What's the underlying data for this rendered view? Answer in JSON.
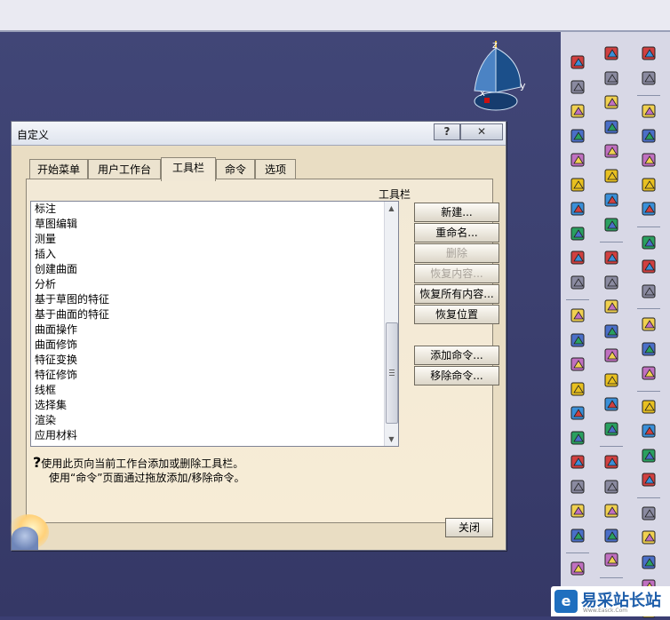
{
  "dialog": {
    "title": "自定义",
    "help_button": "?",
    "close_x": "✕",
    "tabs": [
      {
        "label": "开始菜单",
        "active": false
      },
      {
        "label": "用户工作台",
        "active": false
      },
      {
        "label": "工具栏",
        "active": true
      },
      {
        "label": "命令",
        "active": false
      },
      {
        "label": "选项",
        "active": false
      }
    ],
    "list_header": "工具栏",
    "toolbars": [
      "标注",
      "草图编辑",
      "测量",
      "插入",
      "创建曲面",
      "分析",
      "基于草图的特征",
      "基于曲面的特征",
      "曲面操作",
      "曲面修饰",
      "特征变换",
      "特征修饰",
      "线框",
      "选择集",
      "渲染",
      "应用材料"
    ],
    "buttons": {
      "new": "新建...",
      "rename": "重命名...",
      "delete": "删除",
      "restore_contents": "恢复内容...",
      "restore_all": "恢复所有内容...",
      "restore_position": "恢复位置",
      "add_command": "添加命令...",
      "remove_command": "移除命令..."
    },
    "hint_line1": "使用此页向当前工作台添加或删除工具栏。",
    "hint_line2": "使用“命令”页面通过拖放添加/移除命令。",
    "close_label": "关闭"
  },
  "compass": {
    "z_label": "z",
    "y_label": "y",
    "x_label": "x"
  },
  "watermark": {
    "logo": "e",
    "text": "易采站长站",
    "sub": "Www.Easck.Com"
  }
}
